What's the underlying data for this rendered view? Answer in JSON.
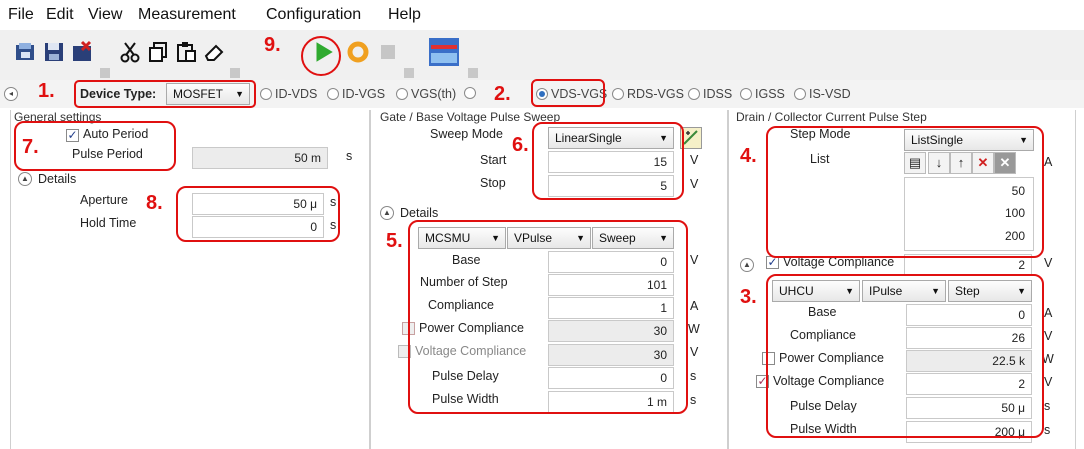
{
  "menu": [
    "File",
    "Edit",
    "View",
    "Measurement",
    "Configuration",
    "Help"
  ],
  "device_type": {
    "label": "Device Type:",
    "value": "MOSFET"
  },
  "measurement_modes": [
    "ID-VDS",
    "ID-VGS",
    "VGS(th)",
    "",
    "VDS-VGS",
    "RDS-VGS",
    "IDSS",
    "IGSS",
    "IS-VSD"
  ],
  "selected_mode": "VDS-VGS",
  "general": {
    "title": "General settings",
    "auto_period": "Auto Period",
    "pulse_period_label": "Pulse Period",
    "pulse_period": "50 m",
    "pulse_period_unit": "s",
    "details": "Details",
    "aperture_label": "Aperture",
    "aperture": "50 μ",
    "aperture_unit": "s",
    "hold_label": "Hold Time",
    "hold": "0",
    "hold_unit": "s"
  },
  "gate": {
    "title": "Gate / Base Voltage Pulse Sweep",
    "sweep_mode_label": "Sweep Mode",
    "sweep_mode": "LinearSingle",
    "start_label": "Start",
    "start": "15",
    "start_unit": "V",
    "stop_label": "Stop",
    "stop": "5",
    "stop_unit": "V",
    "details": "Details",
    "smu": "MCSMU",
    "pulse": "VPulse",
    "mode": "Sweep",
    "base_label": "Base",
    "base": "0",
    "base_unit": "V",
    "nsteps_label": "Number of Step",
    "nsteps": "101",
    "compliance_label": "Compliance",
    "compliance": "1",
    "compliance_unit": "A",
    "power_label": "Power Compliance",
    "power": "30",
    "power_unit": "W",
    "vcomp_label": "Voltage Compliance",
    "vcomp": "30",
    "vcomp_unit": "V",
    "delay_label": "Pulse Delay",
    "delay": "0",
    "delay_unit": "s",
    "width_label": "Pulse Width",
    "width": "1 m",
    "width_unit": "s"
  },
  "drain": {
    "title": "Drain / Collector Current Pulse Step",
    "step_mode_label": "Step Mode",
    "step_mode": "ListSingle",
    "list_label": "List",
    "list_unit": "A",
    "list_values": [
      "50",
      "100",
      "200"
    ],
    "vcomp_top_label": "Voltage Compliance",
    "vcomp_top": "2",
    "vcomp_top_unit": "V",
    "smu": "UHCU",
    "pulse": "IPulse",
    "mode": "Step",
    "base_label": "Base",
    "base": "0",
    "base_unit": "A",
    "compliance_label": "Compliance",
    "compliance": "26",
    "compliance_unit": "V",
    "power_label": "Power Compliance",
    "power": "22.5 k",
    "power_unit": "W",
    "vcomp_label": "Voltage Compliance",
    "vcomp": "2",
    "vcomp_unit": "V",
    "delay_label": "Pulse Delay",
    "delay": "50 μ",
    "delay_unit": "s",
    "width_label": "Pulse Width",
    "width": "200 μ",
    "width_unit": "s"
  },
  "annotations": [
    "1.",
    "2.",
    "3.",
    "4.",
    "5.",
    "6.",
    "7.",
    "8.",
    "9."
  ],
  "colors": {
    "annotation": "#e01010",
    "accent": "#2f6fc0",
    "run": "#2faa2f"
  }
}
